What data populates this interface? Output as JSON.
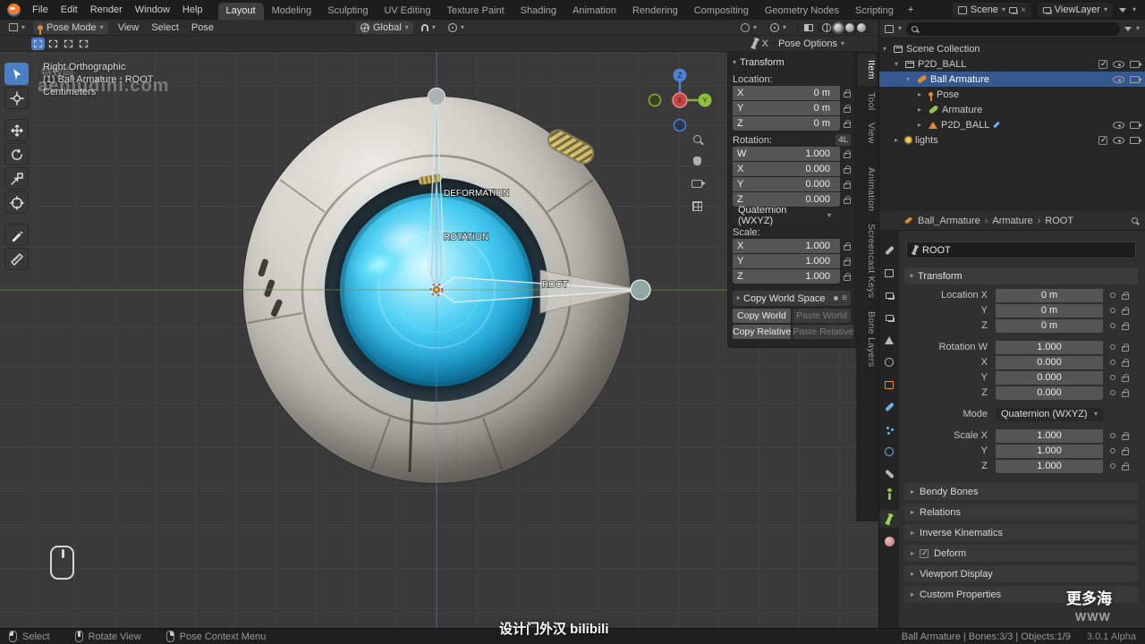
{
  "topbar": {
    "menus": [
      "File",
      "Edit",
      "Render",
      "Window",
      "Help"
    ],
    "workspaces": [
      "Layout",
      "Modeling",
      "Sculpting",
      "UV Editing",
      "Texture Paint",
      "Shading",
      "Animation",
      "Rendering",
      "Compositing",
      "Geometry Nodes",
      "Scripting"
    ],
    "active_workspace": "Layout",
    "add_tab": "+",
    "scene": "Scene",
    "view_layer": "ViewLayer"
  },
  "viewport": {
    "header": {
      "mode": "Pose Mode",
      "menus": [
        "View",
        "Select",
        "Pose"
      ],
      "orientation": "Global",
      "mirror_x": "X",
      "pose_options": "Pose Options"
    },
    "info": [
      "Right Orthographic",
      "(1) Ball Armature : ROOT",
      "Centimeters"
    ],
    "watermark_top": "特效向",
    "watermark_main": "aeniudini.com",
    "bone_labels": {
      "deformation": "DEFORMATION",
      "rotation": "ROTATION",
      "root": "ROOT"
    },
    "gizmo": {
      "x": "X",
      "y": "Y",
      "z": "Z"
    }
  },
  "npanel": {
    "tabs": [
      "Item",
      "Tool",
      "View",
      "Animation",
      "Screencast Keys",
      "Bone Layers"
    ],
    "active_tab": "Item",
    "transform_title": "Transform",
    "location_label": "Location:",
    "location_rows": [
      {
        "axis": "X",
        "value": "0 m"
      },
      {
        "axis": "Y",
        "value": "0 m"
      },
      {
        "axis": "Z",
        "value": "0 m"
      }
    ],
    "rotation_label": "Rotation:",
    "rotation_lock": "4L",
    "rotation_rows": [
      {
        "axis": "W",
        "value": "1.000"
      },
      {
        "axis": "X",
        "value": "0.000"
      },
      {
        "axis": "Y",
        "value": "0.000"
      },
      {
        "axis": "Z",
        "value": "0.000"
      }
    ],
    "rotation_mode": "Quaternion (WXYZ)",
    "scale_label": "Scale:",
    "scale_rows": [
      {
        "axis": "X",
        "value": "1.000"
      },
      {
        "axis": "Y",
        "value": "1.000"
      },
      {
        "axis": "Z",
        "value": "1.000"
      }
    ],
    "copy_panel_title": "Copy World Space",
    "copy_world": "Copy World",
    "paste_world": "Paste World",
    "copy_relative": "Copy Relative",
    "paste_relative": "Paste Relative"
  },
  "outliner": {
    "scene_collection": "Scene Collection",
    "collection_ball": "P2D_BALL",
    "armature_object": "Ball Armature",
    "pose": "Pose",
    "armature_data": "Armature",
    "mesh_object": "P2D_BALL",
    "lights_collection": "lights"
  },
  "properties": {
    "breadcrumb": [
      "Ball_Armature",
      "Armature",
      "ROOT"
    ],
    "breadcrumb_sep": "›",
    "bone_name": "ROOT",
    "transform_title": "Transform",
    "rows_location": [
      {
        "label": "Location X",
        "value": "0 m"
      },
      {
        "label": "Y",
        "value": "0 m"
      },
      {
        "label": "Z",
        "value": "0 m"
      }
    ],
    "rows_rotation": [
      {
        "label": "Rotation W",
        "value": "1.000"
      },
      {
        "label": "X",
        "value": "0.000"
      },
      {
        "label": "Y",
        "value": "0.000"
      },
      {
        "label": "Z",
        "value": "0.000"
      }
    ],
    "mode_label": "Mode",
    "mode_value": "Quaternion (WXYZ)",
    "rows_scale": [
      {
        "label": "Scale X",
        "value": "1.000"
      },
      {
        "label": "Y",
        "value": "1.000"
      },
      {
        "label": "Z",
        "value": "1.000"
      }
    ],
    "panels": [
      "Bendy Bones",
      "Relations",
      "Inverse Kinematics",
      "Deform",
      "Viewport Display",
      "Custom Properties"
    ]
  },
  "statusbar": {
    "keymap": [
      {
        "label": "Select"
      },
      {
        "label": "Rotate View"
      },
      {
        "label": "Pose Context Menu"
      }
    ],
    "stats": "Ball Armature  |  Bones:3/3 | Objects:1/9",
    "version": "3.0.1 Alpha"
  },
  "watermarks": {
    "bottom_center": "设计门外汉 bilibili",
    "bottom_right_main": "更多海",
    "bottom_right_sub": "WWW"
  }
}
